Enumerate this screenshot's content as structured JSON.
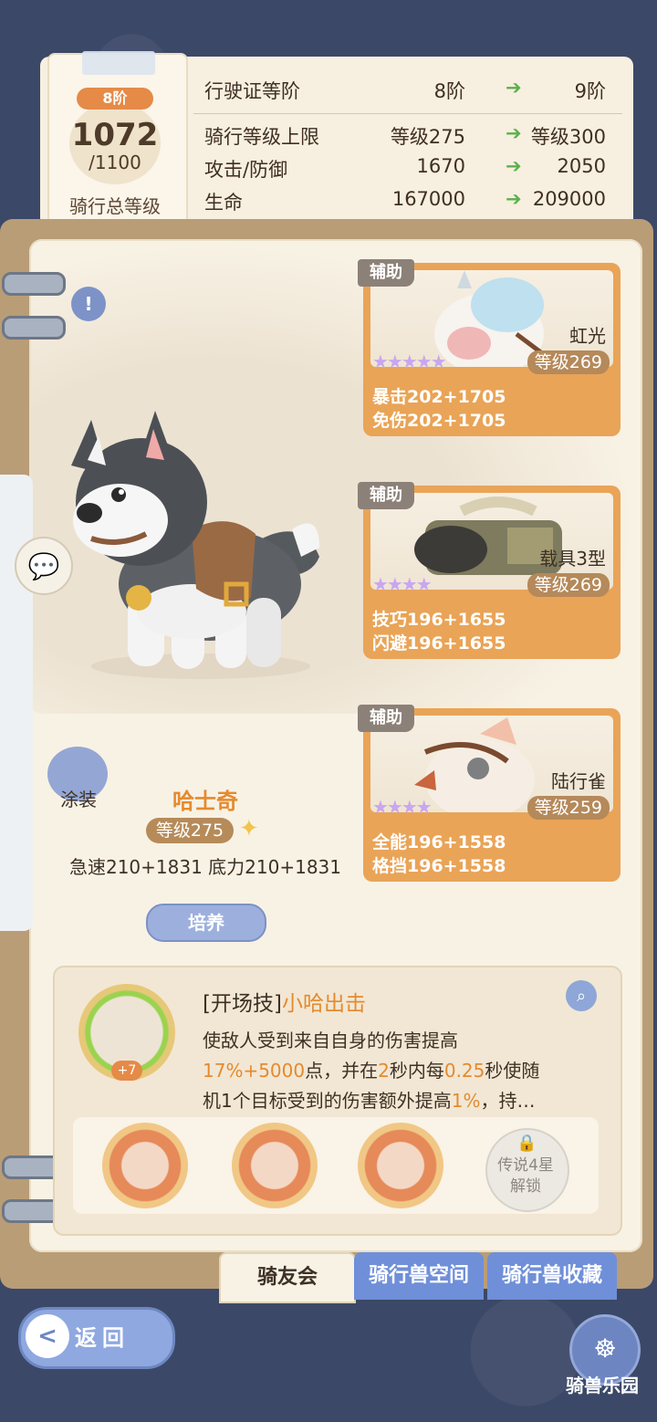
{
  "rank": {
    "badge": "8阶",
    "value": "1072",
    "max": "/1100",
    "label": "骑行总等级"
  },
  "stats": [
    {
      "key": "行驶证等阶",
      "current": "8阶",
      "next": "9阶"
    },
    {
      "key": "骑行等级上限",
      "current": "等级275",
      "next": "等级300"
    },
    {
      "key": "攻击/防御",
      "current": "1670",
      "next": "2050"
    },
    {
      "key": "生命",
      "current": "167000",
      "next": "209000"
    }
  ],
  "mount": {
    "name": "哈士奇",
    "level": "等级275",
    "stats": "急速210+1831  底力210+1831",
    "skin_label": "涂装",
    "train_label": "培养"
  },
  "helpers": [
    {
      "tag": "辅助",
      "name": "虹光",
      "level": "等级269",
      "stars": "★★★★★",
      "line1": "暴击202+1705",
      "line2": "免伤202+1705"
    },
    {
      "tag": "辅助",
      "name": "载具3型",
      "level": "等级269",
      "stars": "★★★★",
      "line1": "技巧196+1655",
      "line2": "闪避196+1655"
    },
    {
      "tag": "辅助",
      "name": "陆行雀",
      "level": "等级259",
      "stars": "★★★★",
      "line1": "全能196+1558",
      "line2": "格挡196+1558"
    }
  ],
  "skill": {
    "prefix": "[开场技]",
    "name": "小哈出击",
    "plus": "+7",
    "desc_1": "使敌人受到来自自身的伤害提高",
    "desc_2a": "17%+5000",
    "desc_2b": "点，并在",
    "desc_2c": "2",
    "desc_2d": "秒内每",
    "desc_2e": "0.25",
    "desc_2f": "秒使随",
    "desc_3a": "机1个目标受到的伤害额外提高",
    "desc_3b": "1%",
    "desc_3c": "，持…",
    "lock_text_1": "传说4星",
    "lock_text_2": "解锁"
  },
  "tabs": {
    "active": "骑友会",
    "tab2": "骑行兽空间",
    "tab3": "骑行兽收藏"
  },
  "back_label": "返回",
  "park_label": "骑兽乐园"
}
